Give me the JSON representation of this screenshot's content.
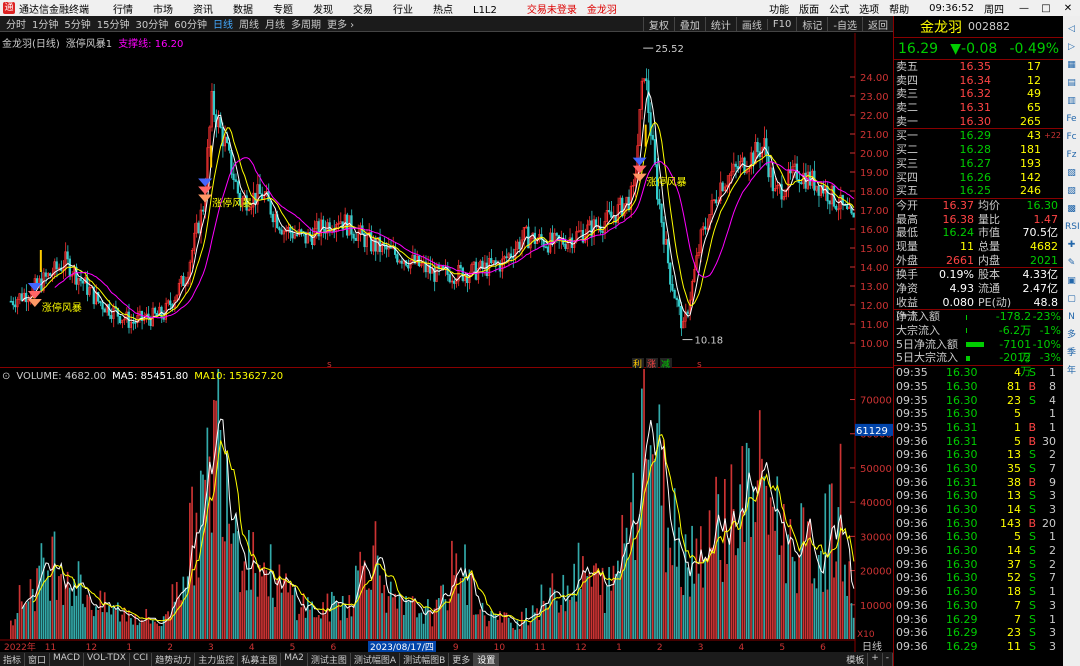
{
  "app": {
    "title": "通达信金融终端",
    "menu": [
      "行情",
      "市场",
      "资讯",
      "数据",
      "专题",
      "发现",
      "交易",
      "行业",
      "热点",
      "L1L2"
    ],
    "status": "交易未登录",
    "stock_link": "金龙羽",
    "right_menu": [
      "功能",
      "版面",
      "公式",
      "选项",
      "帮助"
    ],
    "time": "09:36:52",
    "weekday": "周四"
  },
  "periods": {
    "items": [
      "分时",
      "1分钟",
      "5分钟",
      "15分钟",
      "30分钟",
      "60分钟",
      "日线",
      "周线",
      "月线",
      "多周期",
      "更多 ›"
    ],
    "active": "日线"
  },
  "toolbar": [
    "复权",
    "叠加",
    "统计",
    "画线",
    "F10",
    "标记",
    "-自选",
    "返回"
  ],
  "main_chart": {
    "stock_label": "金龙羽(日线)",
    "indicator": "涨停风暴1",
    "support_label": "支撑线: 16.20",
    "price_ticks": [
      "24.00",
      "23.00",
      "22.00",
      "21.00",
      "20.00",
      "19.00",
      "18.00",
      "17.00",
      "16.00",
      "15.00",
      "14.00",
      "13.00",
      "12.00",
      "11.00",
      "10.00"
    ],
    "high_label": "25.52",
    "low_label": "10.18",
    "signal_text": "涨停风暴",
    "legend_marks": [
      "利",
      "涨",
      "减"
    ]
  },
  "volume_chart": {
    "header": "VOLUME: 4682.00",
    "ma5": "MA5: 85451.80",
    "ma10": "MA10: 153627.20",
    "ticks": [
      "70000",
      "60000",
      "50000",
      "40000",
      "30000",
      "20000",
      "10000"
    ],
    "cursor_value": "61129",
    "unit": "X10",
    "period_label": "日线",
    "date_cursor": "2023/08/17/四",
    "x_labels": [
      "2022年",
      "11",
      "12",
      "1",
      "2",
      "3",
      "4",
      "5",
      "6",
      "7",
      "8",
      "9",
      "10",
      "11",
      "12",
      "1",
      "2",
      "3",
      "4",
      "5",
      "6"
    ]
  },
  "bottom_tabs": {
    "items": [
      "指标",
      "窗口",
      "MACD",
      "VOL-TDX",
      "CCI",
      "趋势动力",
      "主力监控",
      "私募主图",
      "MA2",
      "测试主图",
      "测试幅图A",
      "测试幅图B",
      "更多",
      "设置"
    ],
    "active": "设置",
    "right": [
      "模板",
      "+",
      "-"
    ]
  },
  "quote": {
    "name": "金龙羽",
    "code": "002882",
    "price": "16.29",
    "change": "▼-0.08",
    "pct": "-0.49%",
    "asks": [
      {
        "label": "卖五",
        "price": "16.35",
        "vol": "17"
      },
      {
        "label": "卖四",
        "price": "16.34",
        "vol": "12"
      },
      {
        "label": "卖三",
        "price": "16.32",
        "vol": "49"
      },
      {
        "label": "卖二",
        "price": "16.31",
        "vol": "65"
      },
      {
        "label": "卖一",
        "price": "16.30",
        "vol": "265"
      }
    ],
    "bids": [
      {
        "label": "买一",
        "price": "16.29",
        "vol": "43",
        "extra": "+22"
      },
      {
        "label": "买二",
        "price": "16.28",
        "vol": "181",
        "extra": ""
      },
      {
        "label": "买三",
        "price": "16.27",
        "vol": "193",
        "extra": ""
      },
      {
        "label": "买四",
        "price": "16.26",
        "vol": "142",
        "extra": ""
      },
      {
        "label": "买五",
        "price": "16.25",
        "vol": "246",
        "extra": ""
      }
    ],
    "stats": [
      [
        "今开",
        "16.37",
        "均价",
        "16.30"
      ],
      [
        "最高",
        "16.38",
        "量比",
        "1.47"
      ],
      [
        "最低",
        "16.24",
        "市值",
        "70.5亿"
      ],
      [
        "现量",
        "11",
        "总量",
        "4682"
      ],
      [
        "外盘",
        "2661",
        "内盘",
        "2021"
      ]
    ],
    "stats2": [
      [
        "换手",
        "0.19%",
        "股本",
        "4.33亿"
      ],
      [
        "净资",
        "4.93",
        "流通",
        "2.47亿"
      ],
      [
        "收益(一)",
        "0.080",
        "PE(动)",
        "48.8"
      ]
    ],
    "flows": [
      {
        "label": "净流入额",
        "value": "-178.2万",
        "pct": "-23%",
        "bar": 0
      },
      {
        "label": "大宗流入",
        "value": "-6.2万",
        "pct": "-1%",
        "bar": 0
      },
      {
        "label": "5日净流入额",
        "value": "-7101万",
        "pct": "-10%",
        "bar": 18
      },
      {
        "label": "5日大宗流入",
        "value": "-2012万",
        "pct": "-3%",
        "bar": 4
      }
    ],
    "ticks": [
      [
        "09:35",
        "16.30",
        "4",
        "S",
        "1"
      ],
      [
        "09:35",
        "16.30",
        "81",
        "B",
        "8"
      ],
      [
        "09:35",
        "16.30",
        "23",
        "S",
        "4"
      ],
      [
        "09:35",
        "16.30",
        "5",
        "",
        "1"
      ],
      [
        "09:35",
        "16.31",
        "1",
        "B",
        "1"
      ],
      [
        "09:36",
        "16.31",
        "5",
        "B",
        "30"
      ],
      [
        "09:36",
        "16.30",
        "13",
        "S",
        "2"
      ],
      [
        "09:36",
        "16.30",
        "35",
        "S",
        "7"
      ],
      [
        "09:36",
        "16.31",
        "38",
        "B",
        "9"
      ],
      [
        "09:36",
        "16.30",
        "13",
        "S",
        "3"
      ],
      [
        "09:36",
        "16.30",
        "14",
        "S",
        "3"
      ],
      [
        "09:36",
        "16.30",
        "143",
        "B",
        "20"
      ],
      [
        "09:36",
        "16.30",
        "5",
        "S",
        "1"
      ],
      [
        "09:36",
        "16.30",
        "14",
        "S",
        "2"
      ],
      [
        "09:36",
        "16.30",
        "37",
        "S",
        "2"
      ],
      [
        "09:36",
        "16.30",
        "52",
        "S",
        "7"
      ],
      [
        "09:36",
        "16.30",
        "18",
        "S",
        "1"
      ],
      [
        "09:36",
        "16.30",
        "7",
        "S",
        "3"
      ],
      [
        "09:36",
        "16.29",
        "7",
        "S",
        "1"
      ],
      [
        "09:36",
        "16.29",
        "23",
        "S",
        "3"
      ],
      [
        "09:36",
        "16.29",
        "11",
        "S",
        "3"
      ]
    ]
  },
  "sidebar_icons": [
    "◁",
    "▷",
    "▦",
    "▤",
    "▥",
    "Fe",
    "Fc",
    "Fz",
    "▧",
    "▨",
    "▩",
    "RSI",
    "✚",
    "✎",
    "▣",
    "▢",
    "N",
    "多",
    "季",
    "年"
  ]
}
